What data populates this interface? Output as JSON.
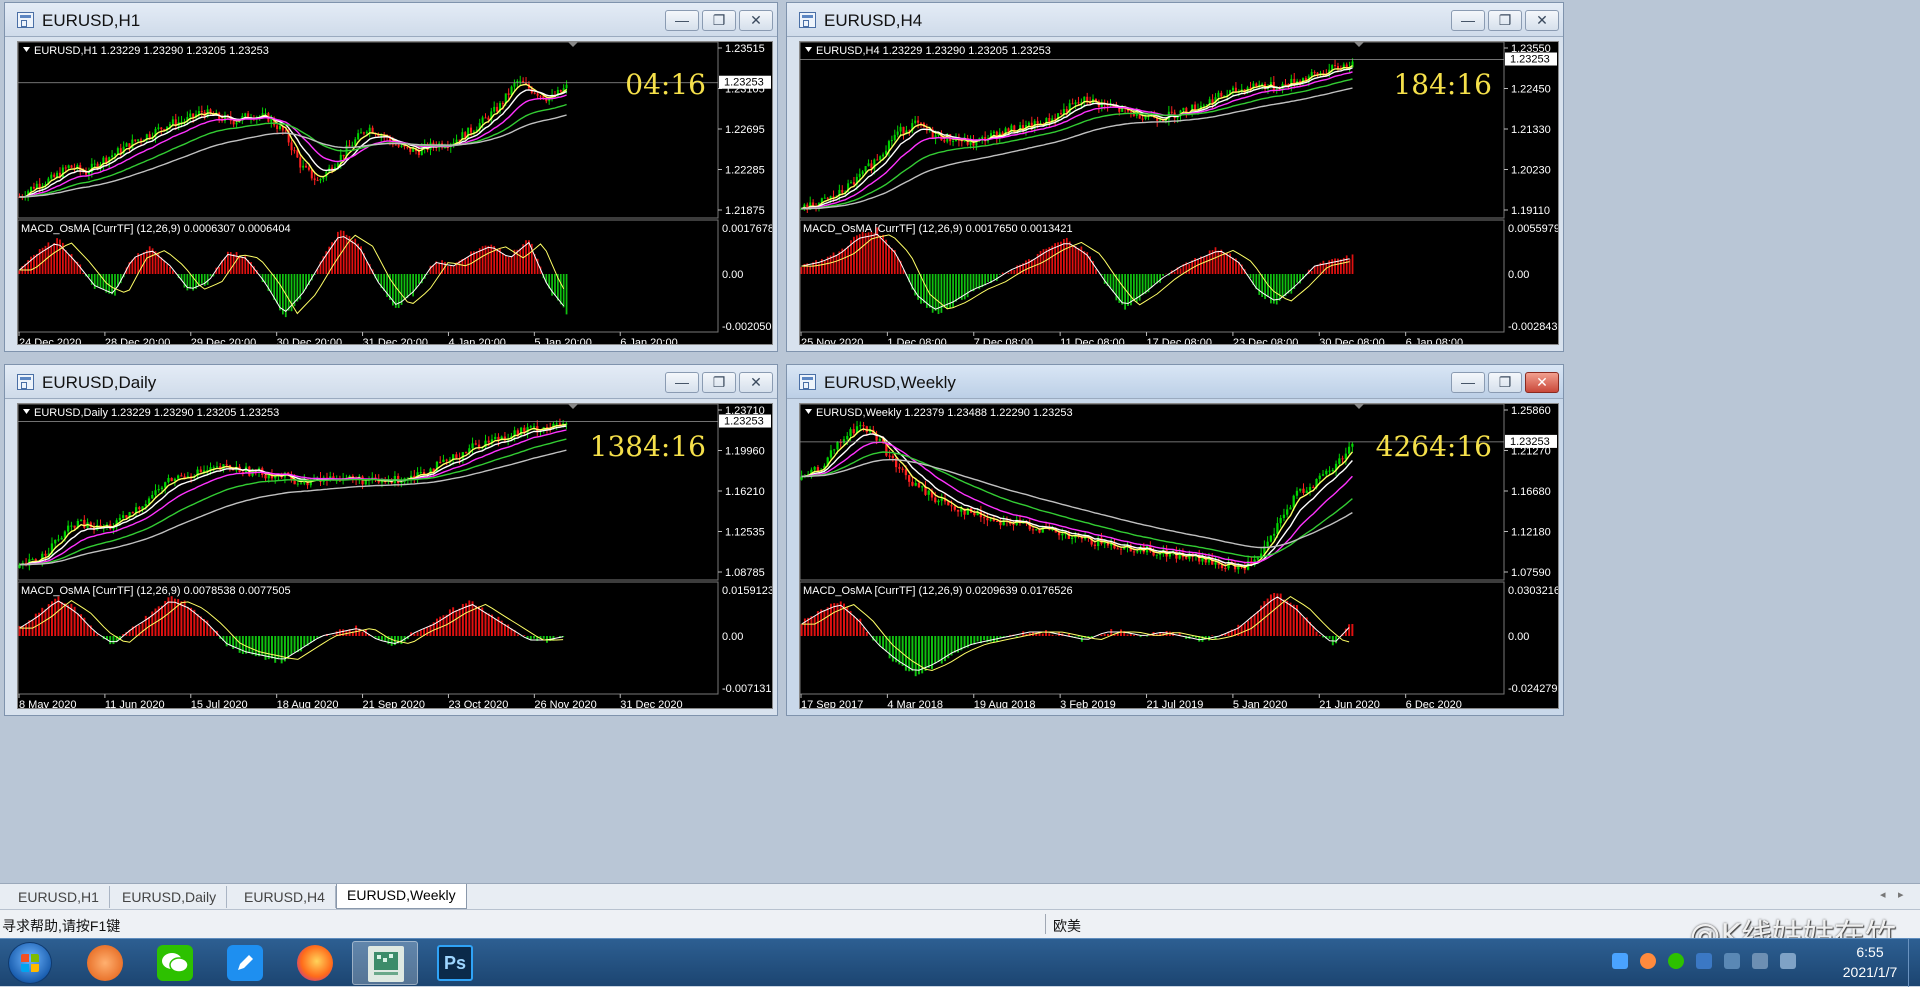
{
  "colors": {
    "bull_candle": "#00d400",
    "bear_candle": "#ff2020",
    "ma_yellow": "#ffff66",
    "ma_white": "#ffffff",
    "ma_magenta": "#ff33ff",
    "ma_green": "#33cc33",
    "ma_gray": "#c0c0c0",
    "timer": "#f5e04a",
    "macd_pos": "#e01010",
    "macd_neg": "#10c010"
  },
  "windows": [
    {
      "title": "EURUSD,H1",
      "info": "EURUSD,H1  1.23229 1.23290 1.23205 1.23253",
      "timer": "04:16",
      "price_label": "1.23253",
      "price_ticks": [
        "1.23515",
        "1.23105",
        "1.22695",
        "1.22285",
        "1.21875"
      ],
      "macd_label": "MACD_OsMA [CurrTF] (12,26,9) 0.0006307 0.0006404",
      "macd_ticks": [
        "0.0017678",
        "0.00",
        "-0.0020503"
      ],
      "time_ticks": [
        "24 Dec 2020",
        "28 Dec 20:00",
        "29 Dec 20:00",
        "30 Dec 20:00",
        "31 Dec 20:00",
        "4 Jan 20:00",
        "5 Jan 20:00",
        "6 Jan 20:00"
      ],
      "price_path": [
        0.1,
        0.18,
        0.22,
        0.3,
        0.26,
        0.34,
        0.4,
        0.47,
        0.52,
        0.58,
        0.6,
        0.66,
        0.62,
        0.6,
        0.64,
        0.62,
        0.52,
        0.3,
        0.2,
        0.32,
        0.44,
        0.56,
        0.5,
        0.42,
        0.4,
        0.44,
        0.46,
        0.52,
        0.6,
        0.7,
        0.86,
        0.8,
        0.74,
        0.82
      ],
      "macd_path": [
        0.1,
        0.5,
        0.8,
        0.3,
        -0.3,
        -0.5,
        0.4,
        0.6,
        0.2,
        -0.4,
        -0.2,
        0.5,
        0.4,
        -0.2,
        -1.0,
        -0.5,
        0.3,
        1.0,
        0.7,
        -0.2,
        -0.8,
        -0.4,
        0.3,
        0.2,
        0.5,
        0.7,
        0.4,
        0.8,
        -0.3,
        -0.9
      ]
    },
    {
      "title": "EURUSD,H4",
      "info": "EURUSD,H4  1.23229 1.23290 1.23205 1.23253",
      "timer": "184:16",
      "price_label": "1.23253",
      "price_ticks": [
        "1.23550",
        "1.22450",
        "1.21330",
        "1.20230",
        "1.19110"
      ],
      "macd_label": "MACD_OsMA [CurrTF] (12,26,9) 0.0017650 0.0013421",
      "macd_ticks": [
        "0.0055979",
        "0.00",
        "-0.0028437"
      ],
      "time_ticks": [
        "25 Nov 2020",
        "1 Dec 08:00",
        "7 Dec 08:00",
        "11 Dec 08:00",
        "17 Dec 08:00",
        "23 Dec 08:00",
        "30 Dec 08:00",
        "6 Jan 08:00"
      ],
      "price_path": [
        0.02,
        0.06,
        0.12,
        0.22,
        0.36,
        0.52,
        0.58,
        0.5,
        0.48,
        0.45,
        0.5,
        0.54,
        0.56,
        0.6,
        0.68,
        0.74,
        0.7,
        0.66,
        0.64,
        0.62,
        0.66,
        0.7,
        0.76,
        0.8,
        0.84,
        0.82,
        0.86,
        0.9,
        0.94,
        0.98
      ],
      "macd_path": [
        0.2,
        0.3,
        0.5,
        0.9,
        1.0,
        0.5,
        -0.5,
        -0.9,
        -0.7,
        -0.4,
        -0.2,
        0.1,
        0.3,
        0.6,
        0.8,
        0.5,
        -0.2,
        -0.8,
        -0.5,
        -0.1,
        0.2,
        0.4,
        0.6,
        0.3,
        -0.4,
        -0.7,
        -0.3,
        0.2,
        0.3,
        0.4
      ]
    },
    {
      "title": "EURUSD,Daily",
      "info": "EURUSD,Daily  1.23229 1.23290 1.23205 1.23253",
      "timer": "1384:16",
      "price_label": "1.23253",
      "price_ticks": [
        "1.23710",
        "1.19960",
        "1.16210",
        "1.12535",
        "1.08785"
      ],
      "macd_label": "MACD_OsMA [CurrTF] (12,26,9) 0.0078538 0.0077505",
      "macd_ticks": [
        "0.0159123",
        "0.00",
        "-0.0071319"
      ],
      "time_ticks": [
        "8 May 2020",
        "11 Jun 2020",
        "15 Jul 2020",
        "18 Aug 2020",
        "21 Sep 2020",
        "23 Oct 2020",
        "26 Nov 2020",
        "31 Dec 2020"
      ],
      "price_path": [
        0.04,
        0.1,
        0.22,
        0.34,
        0.3,
        0.32,
        0.4,
        0.52,
        0.62,
        0.66,
        0.68,
        0.7,
        0.68,
        0.66,
        0.64,
        0.6,
        0.62,
        0.64,
        0.62,
        0.6,
        0.62,
        0.66,
        0.7,
        0.76,
        0.84,
        0.88,
        0.92,
        0.95,
        0.97,
        0.99
      ],
      "macd_path": [
        0.2,
        0.5,
        0.9,
        0.6,
        0.1,
        -0.2,
        0.2,
        0.5,
        0.9,
        0.7,
        0.3,
        -0.2,
        -0.4,
        -0.5,
        -0.6,
        -0.3,
        0.0,
        0.1,
        0.2,
        -0.1,
        -0.2,
        0.1,
        0.3,
        0.6,
        0.8,
        0.5,
        0.2,
        -0.1,
        -0.1,
        0.0
      ]
    },
    {
      "title": "EURUSD,Weekly",
      "info": "EURUSD,Weekly  1.22379 1.23488 1.22290 1.23253",
      "timer": "4264:16",
      "price_label": "1.23253",
      "price_ticks": [
        "1.25860",
        "1.21270",
        "1.16680",
        "1.12180",
        "1.07590"
      ],
      "macd_label": "MACD_OsMA [CurrTF] (12,26,9) 0.0209639 0.0176526",
      "macd_ticks": [
        "0.0303216",
        "0.00",
        "-0.024279"
      ],
      "time_ticks": [
        "17 Sep 2017",
        "4 Mar 2018",
        "19 Aug 2018",
        "3 Feb 2019",
        "21 Jul 2019",
        "5 Jan 2020",
        "21 Jun 2020",
        "6 Dec 2020"
      ],
      "price_path": [
        0.62,
        0.7,
        0.86,
        0.98,
        0.9,
        0.7,
        0.58,
        0.5,
        0.44,
        0.4,
        0.36,
        0.34,
        0.32,
        0.28,
        0.24,
        0.22,
        0.2,
        0.18,
        0.16,
        0.14,
        0.12,
        0.1,
        0.06,
        0.04,
        0.08,
        0.3,
        0.52,
        0.6,
        0.7,
        0.86
      ],
      "macd_path": [
        0.3,
        0.6,
        0.8,
        0.4,
        -0.2,
        -0.6,
        -0.9,
        -0.7,
        -0.4,
        -0.2,
        -0.1,
        0.0,
        0.1,
        0.1,
        0.0,
        -0.1,
        0.1,
        0.1,
        0.0,
        0.1,
        0.0,
        -0.1,
        0.0,
        0.2,
        0.6,
        1.0,
        0.7,
        0.2,
        -0.2,
        0.3
      ]
    }
  ],
  "tabs": [
    "EURUSD,H1",
    "EURUSD,Daily",
    "EURUSD,H4",
    "EURUSD,Weekly"
  ],
  "active_tab": 3,
  "status": {
    "help": "寻求帮助,请按F1键",
    "region": "欧美"
  },
  "watermark": "@K线姑姑在竹",
  "taskbar": {
    "apps": [
      "firefox-alt-icon",
      "wechat-icon",
      "pen-icon",
      "firefox-icon",
      "mt4-icon",
      "photoshop-icon"
    ],
    "ps_label": "Ps",
    "time": "6:55",
    "date": "2021/1/7"
  }
}
